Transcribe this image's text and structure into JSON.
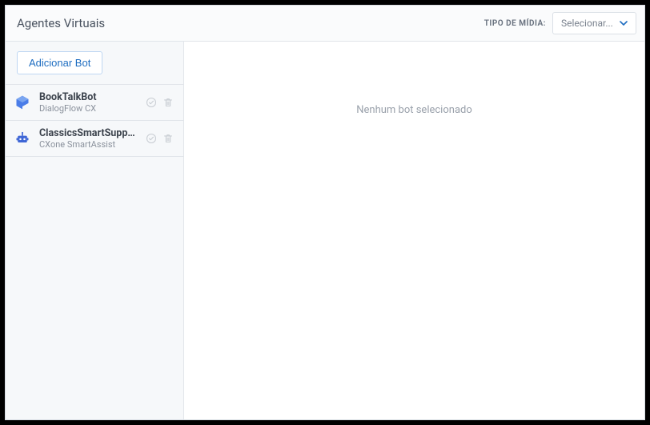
{
  "header": {
    "title": "Agentes Virtuais",
    "media_type_label": "TIPO DE MÍDIA:",
    "media_select_placeholder": "Selecionar..."
  },
  "sidebar": {
    "add_button_label": "Adicionar Bot",
    "bots": [
      {
        "name": "BookTalkBot",
        "provider": "DialogFlow CX",
        "icon": "dialogflow"
      },
      {
        "name": "ClassicsSmartSuppo...",
        "provider": "CXone SmartAssist",
        "icon": "cxone-bot"
      }
    ]
  },
  "main": {
    "empty_message": "Nenhum bot selecionado"
  },
  "colors": {
    "primary": "#1f6ec1",
    "icon_dialogflow": "#4a7de8",
    "icon_cxone": "#3e66d6"
  }
}
